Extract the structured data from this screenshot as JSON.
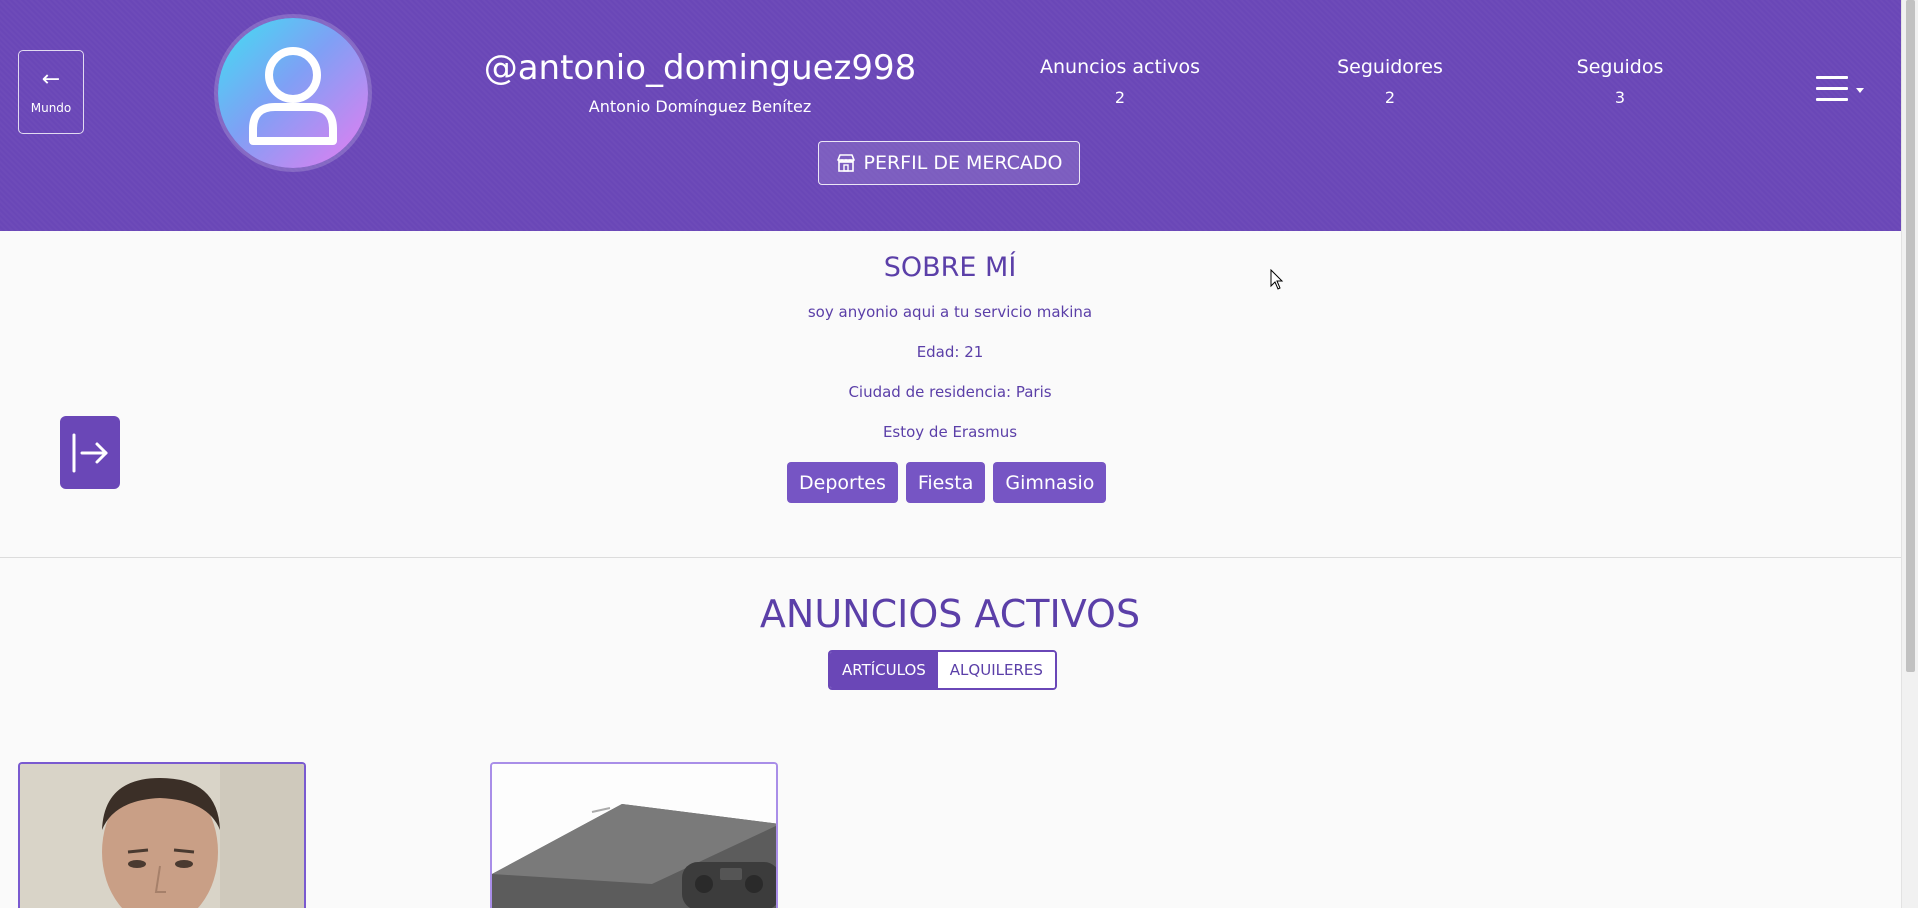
{
  "header": {
    "back": {
      "icon": "arrow-left-icon",
      "label": "Mundo"
    },
    "avatar_icon": "user-icon",
    "username": "@antonio_dominguez998",
    "fullname": "Antonio Domínguez Benítez",
    "stats": [
      {
        "label": "Anuncios activos",
        "value": "2"
      },
      {
        "label": "Seguidores",
        "value": "2"
      },
      {
        "label": "Seguidos",
        "value": "3"
      }
    ],
    "market_button": {
      "icon": "store-icon",
      "label": "PERFIL DE MERCADO"
    },
    "menu_icon": "hamburger-menu-icon"
  },
  "about": {
    "title": "SOBRE MÍ",
    "lines": [
      "soy anyonio aqui a tu servicio makina",
      "Edad: 21",
      "Ciudad de residencia: Paris",
      "Estoy de Erasmus"
    ],
    "tags": [
      "Deportes",
      "Fiesta",
      "Gimnasio"
    ]
  },
  "logout_icon": "logout-arrow-icon",
  "ads": {
    "title": "ANUNCIOS ACTIVOS",
    "tabs": [
      {
        "label": "ARTÍCULOS",
        "active": true
      },
      {
        "label": "ALQUILERES",
        "active": false
      }
    ]
  },
  "cards": [
    {
      "image": "person-photo"
    },
    {
      "image": "game-console-photo"
    }
  ],
  "colors": {
    "primary": "#6a47b7",
    "tag": "#7655c4",
    "text": "#5b3fa8"
  }
}
